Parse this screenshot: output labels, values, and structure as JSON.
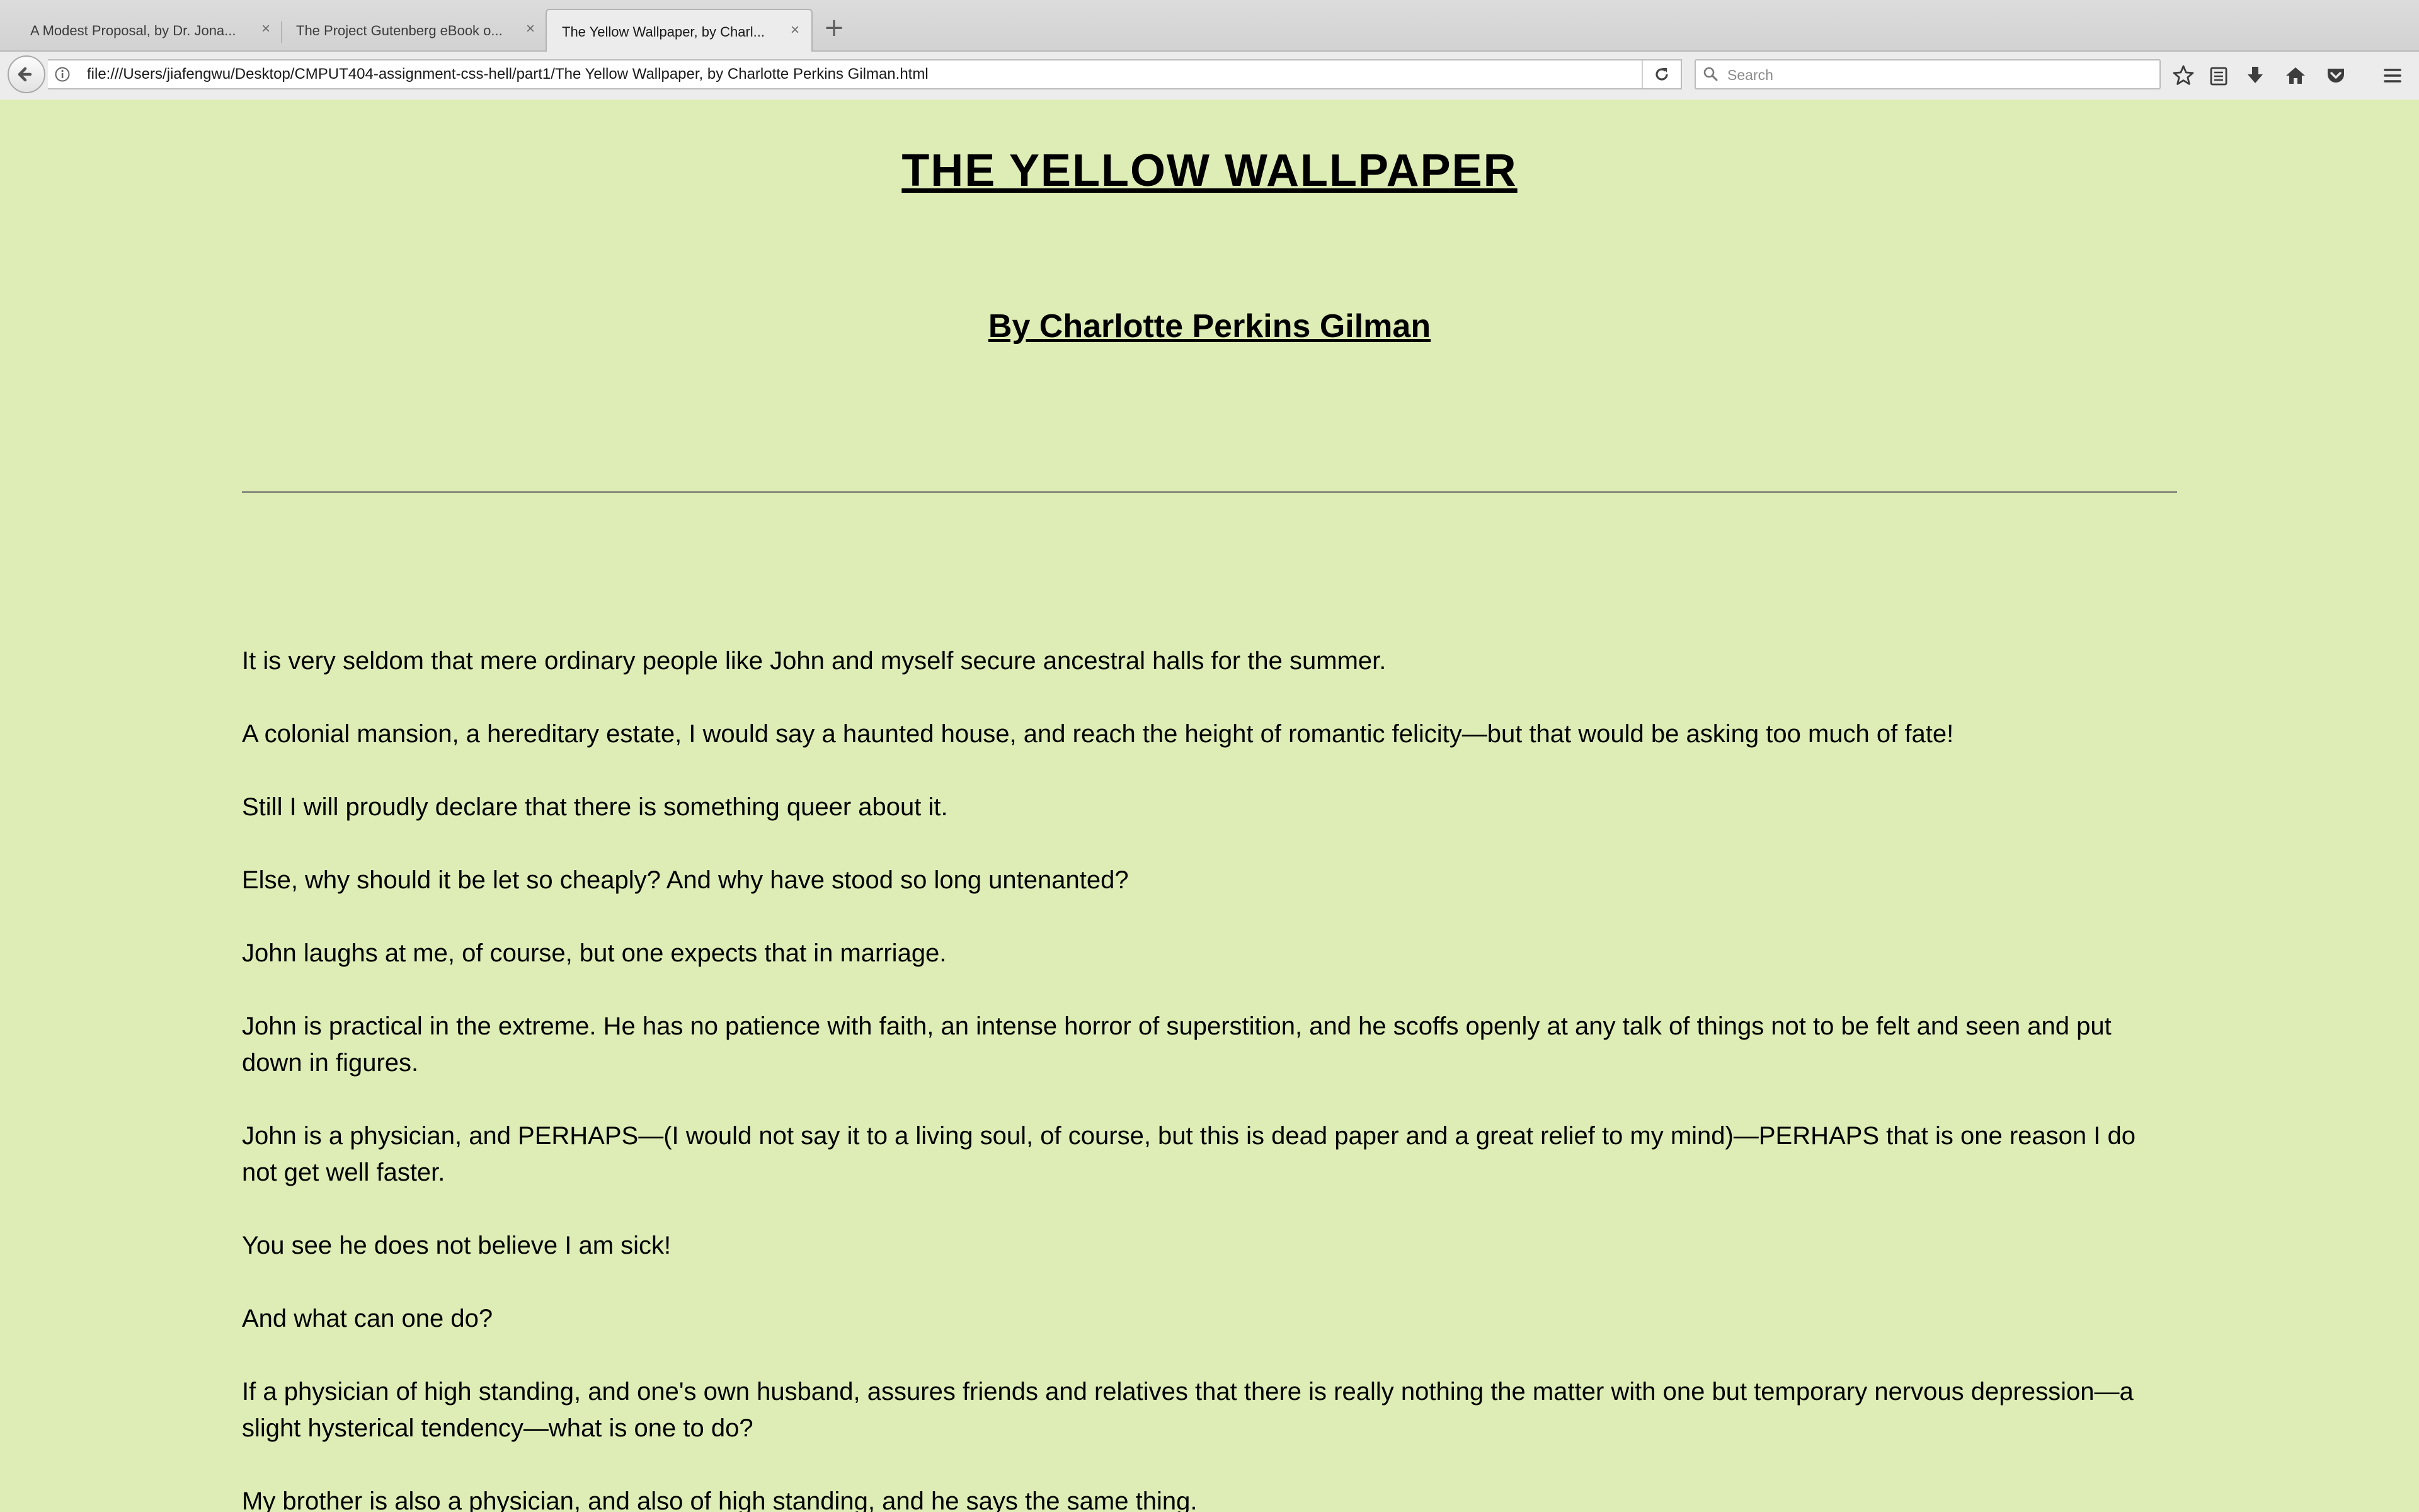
{
  "browser": {
    "tabs": [
      {
        "label": "A Modest Proposal, by Dr. Jona...",
        "active": false
      },
      {
        "label": "The Project Gutenberg eBook o...",
        "active": false
      },
      {
        "label": "The Yellow Wallpaper, by Charl...",
        "active": true
      }
    ],
    "new_tab_label": "+",
    "close_glyph": "×",
    "url": "file:///Users/jiafengwu/Desktop/CMPUT404-assignment-css-hell/part1/The Yellow Wallpaper, by Charlotte Perkins Gilman.html",
    "search_placeholder": "Search",
    "toolbar_icons": [
      "bookmark-star-icon",
      "reading-list-icon",
      "downloads-icon",
      "home-icon",
      "pocket-icon",
      "hamburger-menu-icon"
    ]
  },
  "document": {
    "title": "THE YELLOW WALLPAPER",
    "author": "By Charlotte Perkins Gilman",
    "paragraphs": [
      "It is very seldom that mere ordinary people like John and myself secure ancestral halls for the summer.",
      "A colonial mansion, a hereditary estate, I would say a haunted house, and reach the height of romantic felicity—but that would be asking too much of fate!",
      "Still I will proudly declare that there is something queer about it.",
      "Else, why should it be let so cheaply? And why have stood so long untenanted?",
      "John laughs at me, of course, but one expects that in marriage.",
      "John is practical in the extreme. He has no patience with faith, an intense horror of superstition, and he scoffs openly at any talk of things not to be felt and seen and put down in figures.",
      "John is a physician, and PERHAPS—(I would not say it to a living soul, of course, but this is dead paper and a great relief to my mind)—PERHAPS that is one reason I do not get well faster.",
      "You see he does not believe I am sick!",
      "And what can one do?",
      "If a physician of high standing, and one's own husband, assures friends and relatives that there is really nothing the matter with one but temporary nervous depression—a slight hysterical tendency—what is one to do?",
      "My brother is also a physician, and also of high standing, and he says the same thing."
    ]
  },
  "colors": {
    "page_background": "#ddedb5",
    "text": "#000000",
    "rule": "#6a6a6a"
  }
}
